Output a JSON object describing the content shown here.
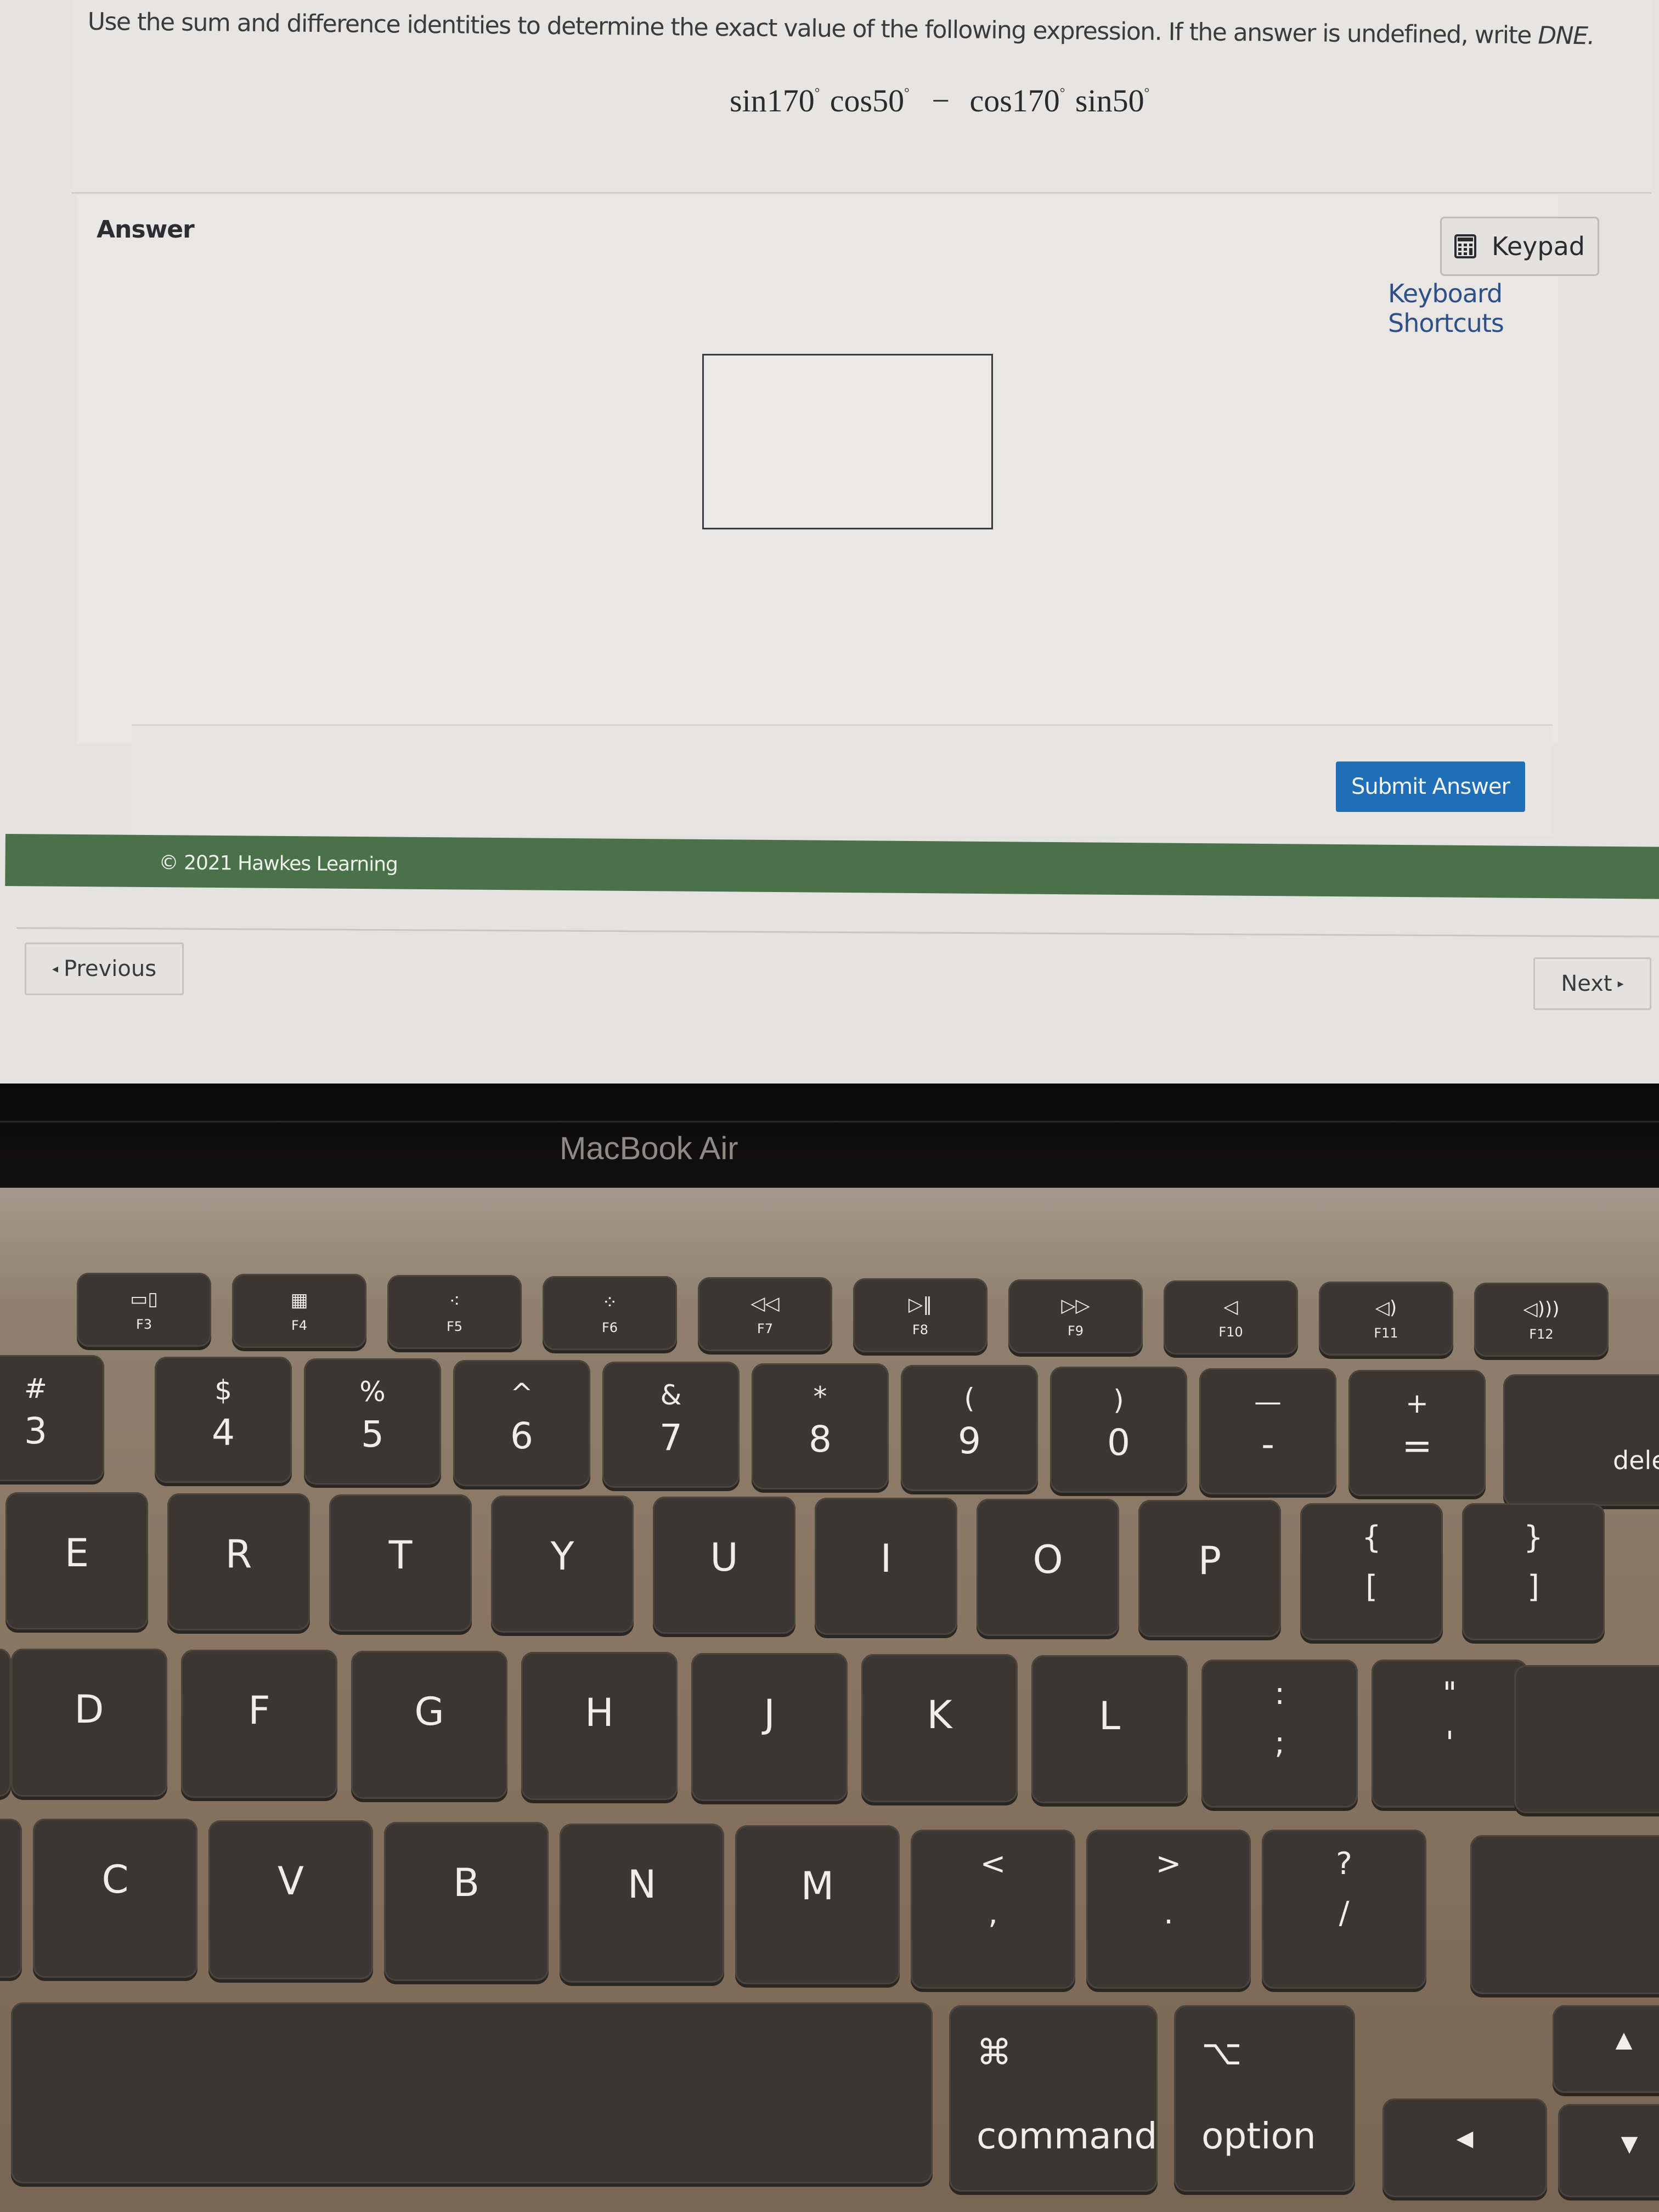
{
  "question": {
    "prompt": "Use the sum and difference identities to determine the exact value of the following expression. If the answer is undefined, write ",
    "prompt_em": "DNE.",
    "expression": {
      "term1_func": "sin",
      "term1_angle": "170",
      "term2_func": "cos",
      "term2_angle": "50",
      "operator": "−",
      "term3_func": "cos",
      "term3_angle": "170",
      "term4_func": "sin",
      "term4_angle": "50",
      "degree_symbol": "°"
    }
  },
  "answer": {
    "label": "Answer",
    "keypad_label": "Keypad",
    "keypad_icon": "calculator-icon",
    "keyboard_shortcuts_label": "Keyboard Shortcuts",
    "input_value": "",
    "submit_label": "Submit Answer"
  },
  "footer": {
    "copyright": "© 2021 Hawkes Learning",
    "brand_color": "#4a7149"
  },
  "navigation": {
    "previous_label": "Previous",
    "previous_arrow": "◂",
    "next_label": "Next",
    "next_arrow": "▸"
  },
  "device": {
    "bezel_label": "MacBook Air"
  },
  "keyboard": {
    "function_row": [
      {
        "icon": "▭▯",
        "label": "F3",
        "name": "mission-control-icon"
      },
      {
        "icon": "▦",
        "label": "F4",
        "name": "launchpad-icon"
      },
      {
        "icon": "⁖",
        "label": "F5",
        "name": "keyboard-brightness-down-icon"
      },
      {
        "icon": "⁘",
        "label": "F6",
        "name": "keyboard-brightness-up-icon"
      },
      {
        "icon": "◁◁",
        "label": "F7",
        "name": "rewind-icon"
      },
      {
        "icon": "▷‖",
        "label": "F8",
        "name": "play-pause-icon"
      },
      {
        "icon": "▷▷",
        "label": "F9",
        "name": "fast-forward-icon"
      },
      {
        "icon": "◁",
        "label": "F10",
        "name": "mute-icon"
      },
      {
        "icon": "◁)",
        "label": "F11",
        "name": "volume-down-icon"
      },
      {
        "icon": "◁)))",
        "label": "F12",
        "name": "volume-up-icon"
      }
    ],
    "number_row": [
      {
        "shift": "#",
        "main": "3"
      },
      {
        "shift": "$",
        "main": "4"
      },
      {
        "shift": "%",
        "main": "5"
      },
      {
        "shift": "^",
        "main": "6"
      },
      {
        "shift": "&",
        "main": "7"
      },
      {
        "shift": "*",
        "main": "8"
      },
      {
        "shift": "(",
        "main": "9"
      },
      {
        "shift": ")",
        "main": "0"
      },
      {
        "shift": "—",
        "main": "-"
      },
      {
        "shift": "+",
        "main": "="
      }
    ],
    "delete_label": "dele",
    "top_letter_row": [
      "E",
      "R",
      "T",
      "Y",
      "U",
      "I",
      "O",
      "P"
    ],
    "top_row_brackets": [
      {
        "top": "{",
        "bottom": "["
      },
      {
        "top": "}",
        "bottom": "]"
      }
    ],
    "home_row": [
      "D",
      "F",
      "G",
      "H",
      "J",
      "K",
      "L"
    ],
    "home_row_punct": [
      {
        "top": ":",
        "bottom": ";"
      },
      {
        "top": "\"",
        "bottom": "'"
      }
    ],
    "bottom_row": [
      "C",
      "V",
      "B",
      "N",
      "M"
    ],
    "bottom_row_punct": [
      {
        "top": "<",
        "bottom": ","
      },
      {
        "top": ">",
        "bottom": "."
      },
      {
        "top": "?",
        "bottom": "/"
      }
    ],
    "command": {
      "symbol": "⌘",
      "label": "command"
    },
    "option": {
      "symbol": "⌥",
      "label": "option"
    },
    "arrows": {
      "left": "◀",
      "up": "▲",
      "down": "▼"
    }
  }
}
